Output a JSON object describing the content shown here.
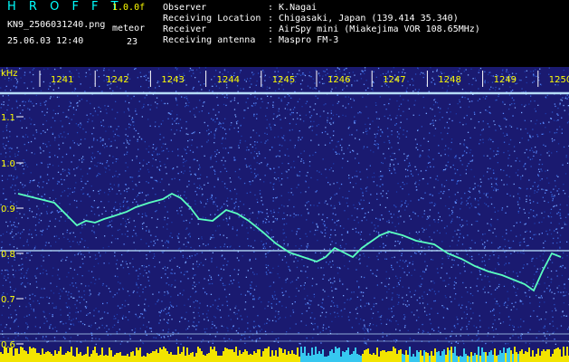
{
  "header": {
    "app_title": "H R O F F T",
    "version": "1.0.0f",
    "filename": "KN9_2506031240.png",
    "meteor_label": "meteor",
    "datetime": "25.06.03 12:40",
    "meteor_count": "23"
  },
  "meta": [
    {
      "label": "Observer",
      "value": ": K.Nagai"
    },
    {
      "label": "Receiving Location",
      "value": ": Chigasaki, Japan (139.414 35.340)"
    },
    {
      "label": "Receiver",
      "value": ": AirSpy mini (Miakejima VOR 108.65MHz)"
    },
    {
      "label": "Receiving antenna",
      "value": ": Maspro FM-3"
    }
  ],
  "plot": {
    "unit_label": "kHz",
    "time_ticks": [
      "1241",
      "1242",
      "1243",
      "1244",
      "1245",
      "1246",
      "1247",
      "1248",
      "1249",
      "1250"
    ],
    "freq_ticks": [
      "1.1",
      "1.0",
      "0.9",
      "0.8",
      "0.7",
      "0.6"
    ],
    "colors": {
      "background": "#1a1a70",
      "noise": "#3a6adf",
      "signal_line": "#5affc0",
      "carrier": "#bfe8ff",
      "label": "#ffff00",
      "tick": "#ffffff",
      "bottom_yellow": "#f2e400",
      "bottom_cyan": "#36c8f0"
    }
  }
}
